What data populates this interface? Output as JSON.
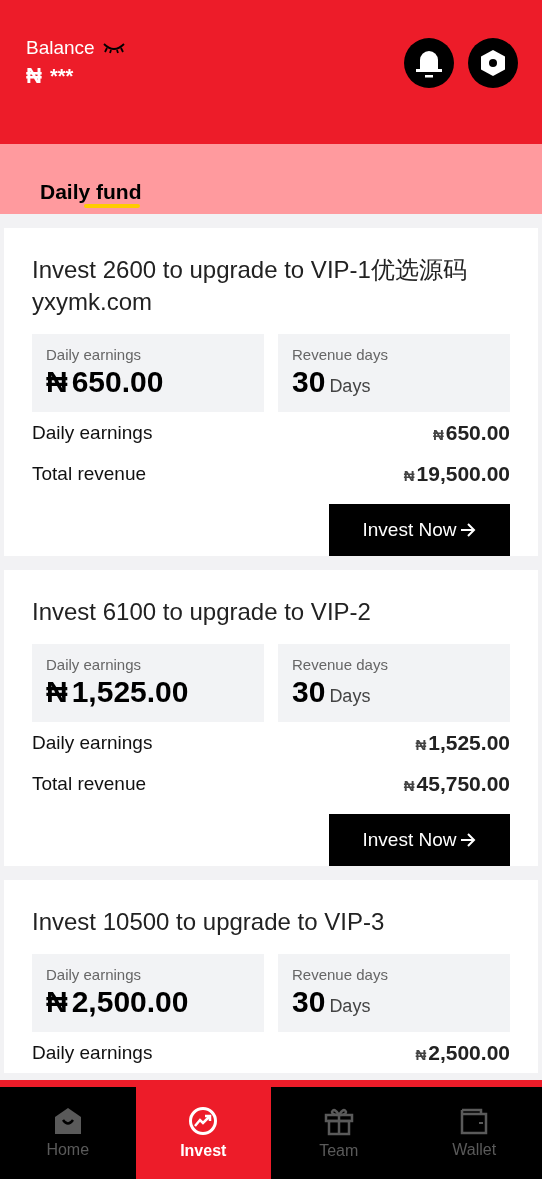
{
  "header": {
    "balance_label": "Balance",
    "currency": "₦",
    "balance_hidden": "***"
  },
  "tabs": [
    {
      "label": "Daily fund",
      "selected": true
    }
  ],
  "plans": [
    {
      "title": "Invest 2600 to upgrade to VIP-1优选源码yxymk.com",
      "stats": [
        {
          "kind": "money",
          "label": "Daily earnings",
          "currency": "₦",
          "value": "650.00"
        },
        {
          "kind": "days",
          "label": "Revenue days",
          "value": "30",
          "unit": "Days"
        }
      ],
      "rows": [
        {
          "label": "Daily earnings",
          "currency": "₦",
          "value": "650.00"
        },
        {
          "label": "Total revenue",
          "currency": "₦",
          "value": "19,500.00"
        }
      ],
      "button": "Invest Now"
    },
    {
      "title": "Invest 6100 to upgrade to VIP-2",
      "stats": [
        {
          "kind": "money",
          "label": "Daily earnings",
          "currency": "₦",
          "value": "1,525.00"
        },
        {
          "kind": "days",
          "label": "Revenue days",
          "value": "30",
          "unit": "Days"
        }
      ],
      "rows": [
        {
          "label": "Daily earnings",
          "currency": "₦",
          "value": "1,525.00"
        },
        {
          "label": "Total revenue",
          "currency": "₦",
          "value": "45,750.00"
        }
      ],
      "button": "Invest Now"
    },
    {
      "title": "Invest 10500 to upgrade to VIP-3",
      "stats": [
        {
          "kind": "money",
          "label": "Daily earnings",
          "currency": "₦",
          "value": "2,500.00"
        },
        {
          "kind": "days",
          "label": "Revenue days",
          "value": "30",
          "unit": "Days"
        }
      ],
      "rows": [
        {
          "label": "Daily earnings",
          "currency": "₦",
          "value": "2,500.00"
        }
      ]
    }
  ],
  "nav": [
    {
      "kind": "home",
      "label": "Home",
      "selected": false
    },
    {
      "kind": "invest",
      "label": "Invest",
      "selected": true
    },
    {
      "kind": "team",
      "label": "Team",
      "selected": false
    },
    {
      "kind": "wallet",
      "label": "Wallet",
      "selected": false
    }
  ]
}
